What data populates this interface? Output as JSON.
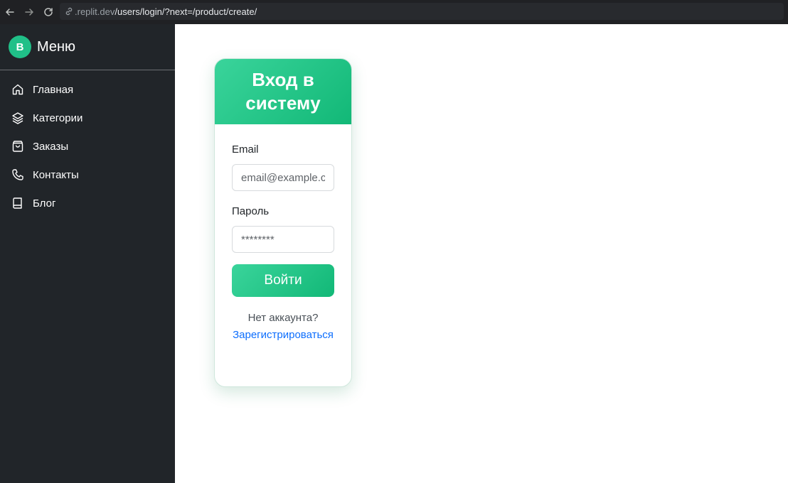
{
  "browser": {
    "url_host": ".replit.dev",
    "url_path": "/users/login/?next=/product/create/"
  },
  "sidebar": {
    "logo_letter": "B",
    "title": "Меню",
    "items": [
      {
        "label": "Главная",
        "icon": "home-icon"
      },
      {
        "label": "Категории",
        "icon": "layers-icon"
      },
      {
        "label": "Заказы",
        "icon": "shopping-bag-icon"
      },
      {
        "label": "Контакты",
        "icon": "phone-icon"
      },
      {
        "label": "Блог",
        "icon": "book-icon"
      }
    ]
  },
  "login": {
    "title": "Вход в системy",
    "email_label": "Email",
    "email_placeholder": "email@example.com",
    "password_label": "Пароль",
    "password_placeholder": "********",
    "submit_label": "Войти",
    "no_account_text": "Нет аккаунта?",
    "register_link": "Зарегистрироваться"
  },
  "colors": {
    "sidebar_bg": "#212529",
    "accent": "#20c088",
    "link": "#0d6efd"
  }
}
